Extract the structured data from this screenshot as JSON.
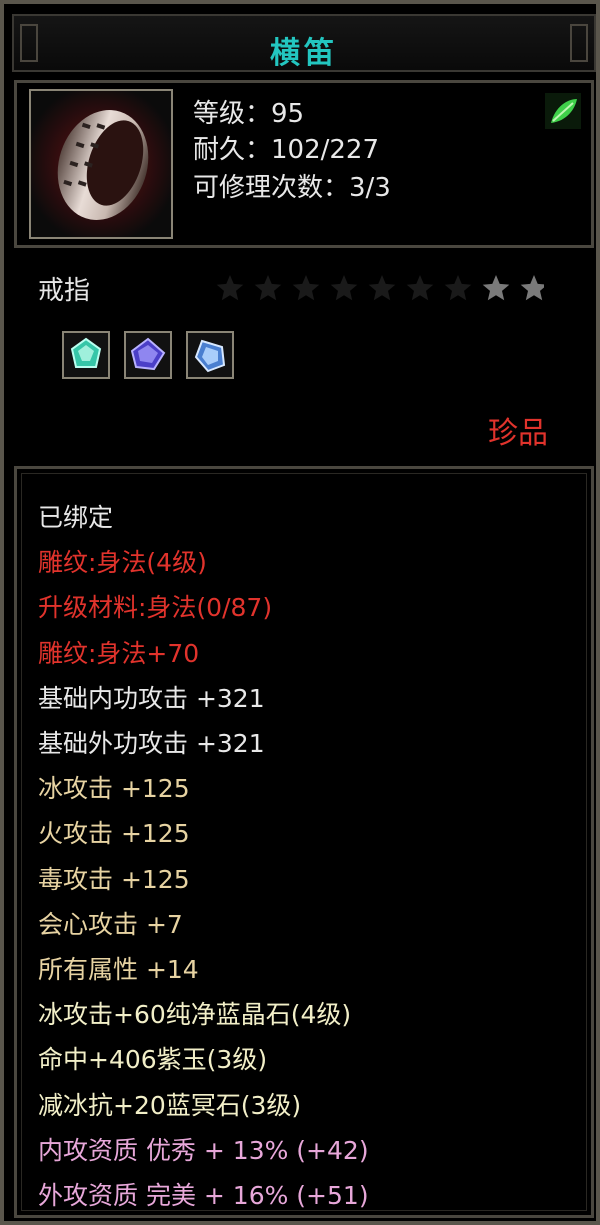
{
  "title": "横笛",
  "stats": {
    "level": "等级：95",
    "durability": "耐久：102/227",
    "repair": "可修理次数：3/3"
  },
  "item_type": "戒指",
  "stars": {
    "total": 9,
    "lit": 2
  },
  "sockets": [
    "green-gem-icon",
    "purple-gem-icon",
    "blue-gem-icon"
  ],
  "rarity": "珍品",
  "colors": {
    "title": "#23c6c0",
    "red": "#e1332c",
    "white": "#e8e8e8",
    "yellow": "#e7d3a2",
    "pink": "#e7a7d9"
  },
  "attributes": [
    {
      "text": "已绑定",
      "color": "#e8e8e8"
    },
    {
      "text": "雕纹:身法(4级)",
      "color": "#e1332c"
    },
    {
      "text": "升级材料:身法(0/87)",
      "color": "#e1332c"
    },
    {
      "text": "雕纹:身法+70",
      "color": "#e1332c"
    },
    {
      "text": "基础内功攻击 +321",
      "color": "#e8e8e8"
    },
    {
      "text": "基础外功攻击 +321",
      "color": "#e8e8e8"
    },
    {
      "text": "冰攻击 +125",
      "color": "#e7d3a2"
    },
    {
      "text": "火攻击 +125",
      "color": "#e7d3a2"
    },
    {
      "text": "毒攻击 +125",
      "color": "#e7d3a2"
    },
    {
      "text": "会心攻击 +7",
      "color": "#e7d3a2"
    },
    {
      "text": "所有属性 +14",
      "color": "#e7d3a2"
    },
    {
      "text": "冰攻击+60纯净蓝晶石(4级)",
      "color": "#f2efc8"
    },
    {
      "text": "命中+406紫玉(3级)",
      "color": "#f2efc8"
    },
    {
      "text": "减冰抗+20蓝冥石(3级)",
      "color": "#f2efc8"
    },
    {
      "text": "内攻资质 优秀 + 13% (+42)",
      "color": "#e7a7d9"
    },
    {
      "text": "外攻资质 完美 + 16% (+51)",
      "color": "#e7a7d9"
    }
  ]
}
